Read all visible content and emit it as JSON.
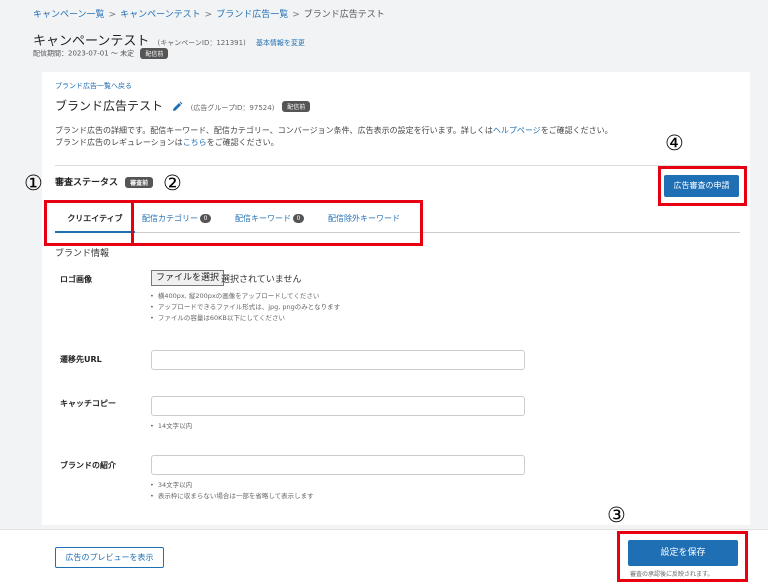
{
  "breadcrumb": {
    "items": [
      "キャンペーン一覧",
      "キャンペーンテスト",
      "ブランド広告一覧",
      "ブランド広告テスト"
    ],
    "separator": ">"
  },
  "campaign": {
    "title": "キャンペーンテスト",
    "id_text": "(キャンペーンID：121391)",
    "edit_link": "基本情報を変更",
    "period": "配信期間：2023-07-01 ～ 未定",
    "status_badge": "配信前"
  },
  "brand": {
    "back_link": "ブランド広告一覧へ戻る",
    "title": "ブランド広告テスト",
    "group_id_text": "(広告グループID：97524)",
    "status_badge": "配信前",
    "desc_line1_a": "ブランド広告の詳細です。配信キーワード、配信カテゴリー、コンバージョン条件、広告表示の設定を行います。詳しくは",
    "desc_line1_link": "ヘルプページ",
    "desc_line1_b": "をご確認ください。",
    "desc_line2_a": "ブランド広告のレギュレーションは",
    "desc_line2_link": "こちら",
    "desc_line2_b": "をご確認ください。"
  },
  "review": {
    "label": "審査ステータス",
    "badge": "審査前",
    "apply_button": "広告審査の申請"
  },
  "tabs": [
    {
      "label": "クリエイティブ",
      "count": ""
    },
    {
      "label": "配信カテゴリー",
      "count": "0"
    },
    {
      "label": "配信キーワード",
      "count": "0"
    },
    {
      "label": "配信除外キーワード",
      "count": ""
    }
  ],
  "form": {
    "section_title": "ブランド情報",
    "logo": {
      "label": "ロゴ画像",
      "file_button": "ファイルを選択",
      "file_status": "選択されていません",
      "hints": [
        "横400px, 縦200pxの画像をアップロードしてください",
        "アップロードできるファイル形式は、jpg, pngのみとなります",
        "ファイルの容量は60KB以下にしてください"
      ]
    },
    "url": {
      "label": "遷移先URL",
      "value": ""
    },
    "catch": {
      "label": "キャッチコピー",
      "value": "",
      "hints": [
        "14文字以内"
      ]
    },
    "intro": {
      "label": "ブランドの紹介",
      "value": "",
      "hints": [
        "34文字以内",
        "表示枠に収まらない場合は一部を省略して表示します"
      ]
    }
  },
  "footer": {
    "preview_button": "広告のプレビューを表示",
    "save_button": "設定を保存",
    "save_note": "審査の承認後に反映されます。"
  },
  "callouts": [
    "①",
    "②",
    "③",
    "④"
  ],
  "colors": {
    "accent": "#1f6fb5",
    "callout": "#e60012",
    "badge": "#555555"
  }
}
